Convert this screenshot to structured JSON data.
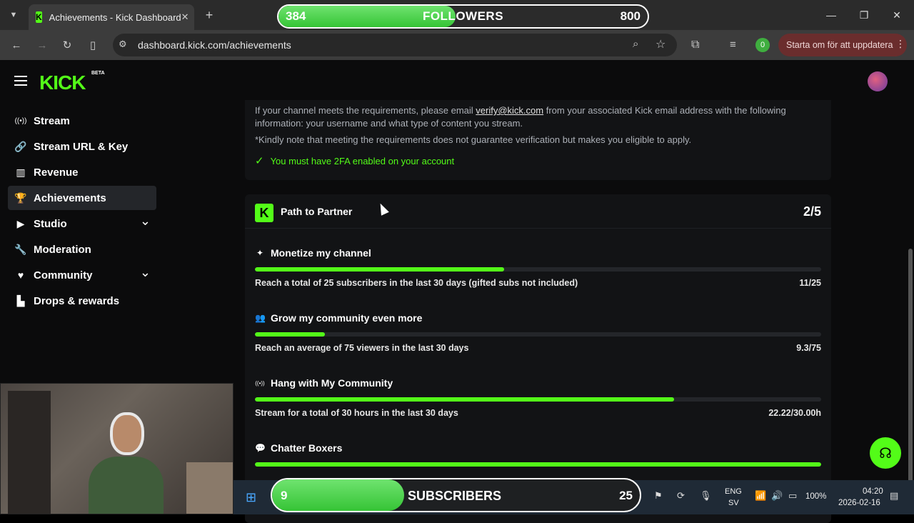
{
  "browser": {
    "tab_title": "Achievements - Kick Dashboard",
    "tab_favicon": "K",
    "tab_close": "✕",
    "new_tab": "+",
    "url": "dashboard.kick.com/achievements",
    "profile_count": "0",
    "update_button": "Starta om för att uppdatera",
    "window_controls": {
      "minimize": "—",
      "restore": "❐",
      "close": "✕"
    }
  },
  "followers_overlay": {
    "current": "384",
    "label": "FOLLOWERS",
    "goal": "800",
    "progress": 0.48
  },
  "header": {
    "logo": "KICK",
    "logo_badge": "BETA"
  },
  "sidebar": {
    "items": [
      {
        "label": "Stream",
        "icon": "broadcast-icon",
        "glyph": "((•))",
        "active": false,
        "expandable": false
      },
      {
        "label": "Stream URL & Key",
        "icon": "link-icon",
        "glyph": "🔗",
        "active": false,
        "expandable": false
      },
      {
        "label": "Revenue",
        "icon": "chart-icon",
        "glyph": "▥",
        "active": false,
        "expandable": false
      },
      {
        "label": "Achievements",
        "icon": "trophy-icon",
        "glyph": "🏆",
        "active": true,
        "expandable": false
      },
      {
        "label": "Studio",
        "icon": "video-icon",
        "glyph": "▶",
        "active": false,
        "expandable": true
      },
      {
        "label": "Moderation",
        "icon": "wrench-icon",
        "glyph": "🔧",
        "active": false,
        "expandable": false
      },
      {
        "label": "Community",
        "icon": "heart-icon",
        "glyph": "♥",
        "active": false,
        "expandable": true
      },
      {
        "label": "Drops & rewards",
        "icon": "bar-chart-icon",
        "glyph": "▙",
        "active": false,
        "expandable": false
      }
    ]
  },
  "verification": {
    "text_before": "If your channel meets the requirements, please email ",
    "email": "verify@kick.com",
    "text_after": " from your associated Kick email address with the following information: your username and what type of content you stream.",
    "note": "*Kindly note that meeting the requirements does not guarantee verification but makes you eligible to apply.",
    "requirement": "You must have 2FA enabled on your account"
  },
  "path_to_partner": {
    "title": "Path to Partner",
    "progress": "2/5",
    "achievements": [
      {
        "title": "Monetize my channel",
        "icon": "sparkle-icon",
        "glyph": "✦",
        "description": "Reach a total of 25 subscribers in the last 30 days (gifted subs not included)",
        "value": "11/25",
        "fraction": 0.44
      },
      {
        "title": "Grow my community even more",
        "icon": "users-icon",
        "glyph": "👥",
        "description": "Reach an average of 75 viewers in the last 30 days",
        "value": "9.3/75",
        "fraction": 0.124
      },
      {
        "title": "Hang with My Community",
        "icon": "broadcast-icon",
        "glyph": "((•))",
        "description": "Stream for a total of 30 hours in the last 30 days",
        "value": "22.22/30.00h",
        "fraction": 0.74
      },
      {
        "title": "Chatter Boxers",
        "icon": "chat-icon",
        "glyph": "💬",
        "description": "",
        "value": "",
        "fraction": 1.0
      }
    ]
  },
  "subscribers_overlay": {
    "current": "9",
    "label": "SUBSCRIBERS",
    "goal": "25",
    "progress": 0.36
  },
  "taskbar": {
    "language_top": "ENG",
    "language_bottom": "SV",
    "battery": "100%",
    "time": "04:20",
    "date": "2026-02-16"
  },
  "colors": {
    "accent": "#53fc18",
    "background": "#0b0b0c",
    "card": "#121315"
  }
}
